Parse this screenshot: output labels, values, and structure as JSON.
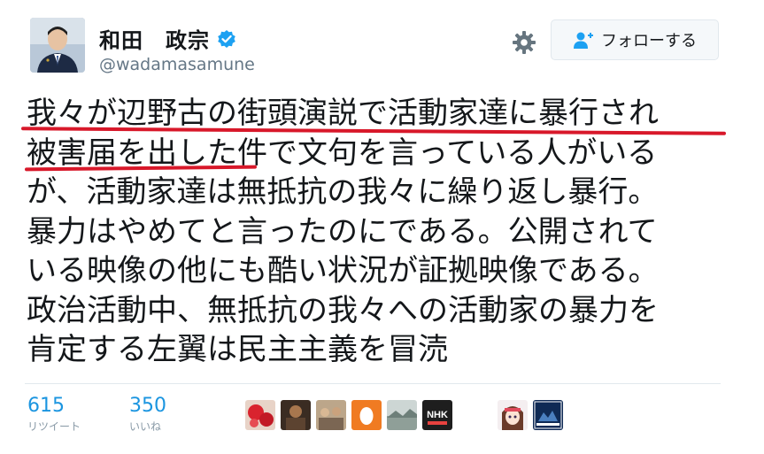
{
  "user": {
    "display_name": "和田　政宗",
    "handle": "@wadamasamune"
  },
  "actions": {
    "follow_label": "フォローする"
  },
  "tweet": {
    "lines": [
      "我々が辺野古の街頭演説で活動家達に暴行され",
      "被害届を出した件で文句を言っている人がいる",
      "が、活動家達は無抵抗の我々に繰り返し暴行。",
      "暴力はやめてと言ったのにである。公開されて",
      "いる映像の他にも酷い状況が証拠映像である。",
      "政治活動中、無抵抗の我々への活動家の暴力を",
      "肯定する左翼は民主主義を冒涜"
    ]
  },
  "stats": {
    "retweets": {
      "count": "615",
      "label": "リツイート"
    },
    "likes": {
      "count": "350",
      "label": "いいね"
    }
  },
  "likers": [
    {
      "icon": "red-floral-avatar"
    },
    {
      "icon": "dark-photo-avatar"
    },
    {
      "icon": "group-photo-avatar"
    },
    {
      "icon": "default-egg-avatar"
    },
    {
      "icon": "landscape-photo-avatar"
    },
    {
      "icon": "nhk-logo-avatar"
    },
    {
      "icon": "anime-girl-avatar"
    },
    {
      "icon": "takeshima-avatar"
    }
  ],
  "colors": {
    "accent": "#1b95e0",
    "underline": "#d8182a",
    "egg": "#f07b22"
  }
}
